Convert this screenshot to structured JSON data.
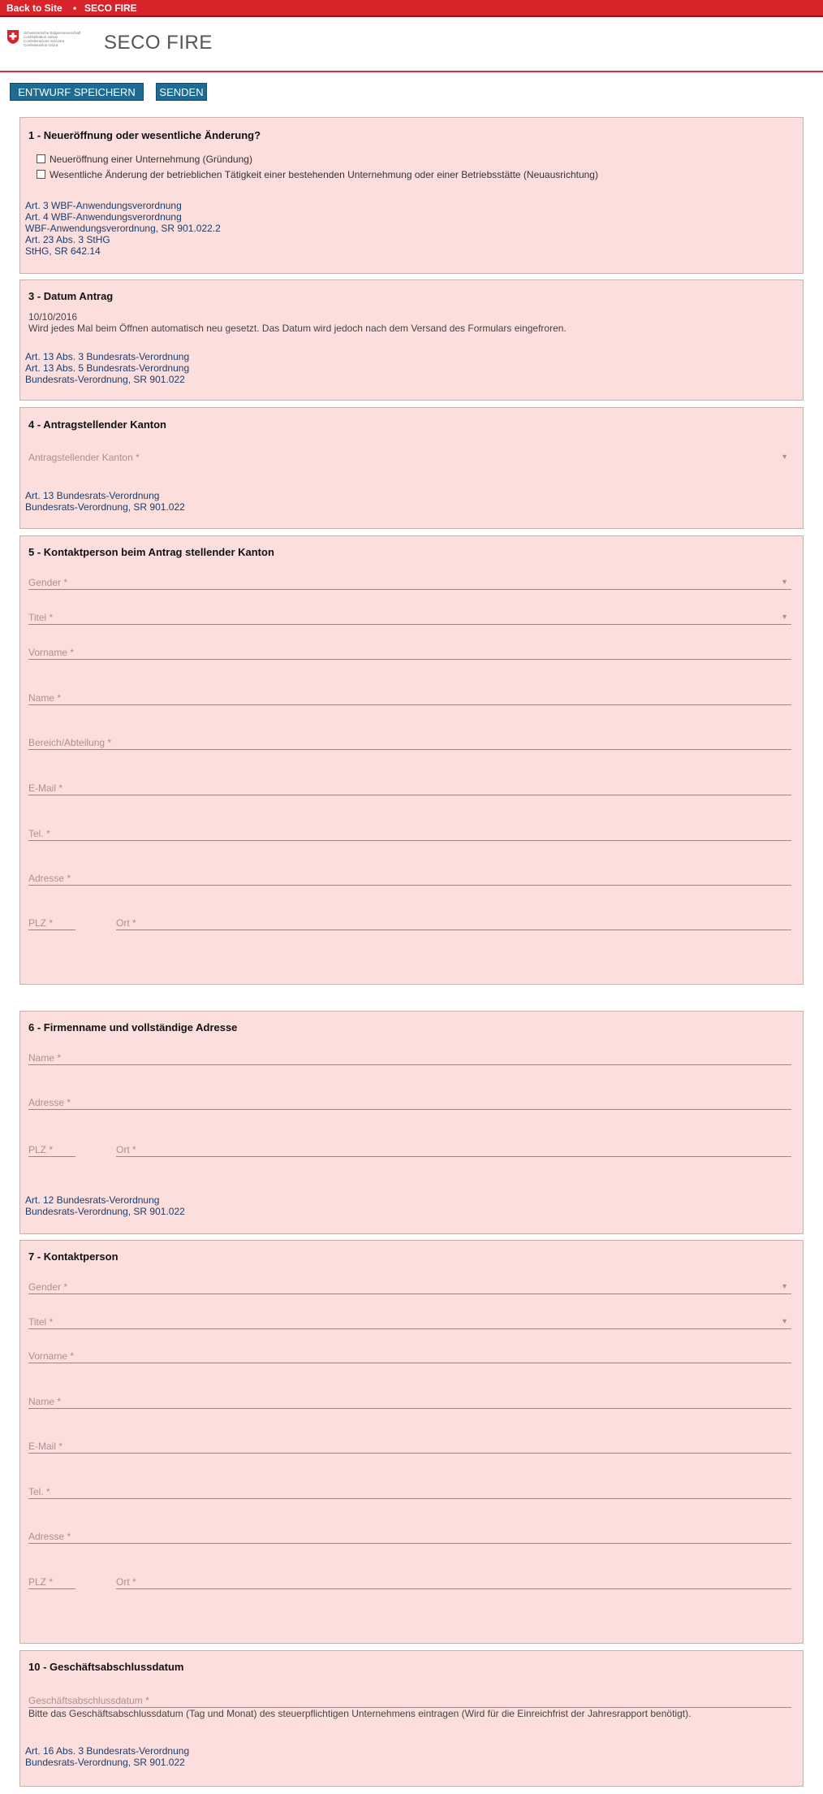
{
  "topbar": {
    "back_link": "Back to Site",
    "separator": "•",
    "site_link": "SECO FIRE"
  },
  "header": {
    "admin_lines": "Schweizerische Eidgenossenschaft\nConfédération suisse\nConfederazione Svizzera\nConfederaziun svizra",
    "site_name": "SECO FIRE"
  },
  "toolbar": {
    "save_draft": "Entwurf speichern",
    "send": "Senden"
  },
  "s1": {
    "title": "1 - Neueröffnung oder wesentliche Änderung?",
    "opt1": "Neueröffnung einer Unternehmung (Gründung)",
    "opt2": "Wesentliche Änderung der betrieblichen Tätigkeit einer bestehenden Unternehmung oder einer Betriebsstätte (Neuausrichtung)",
    "refs": [
      "Art. 3 WBF-Anwendungsverordnung",
      "Art. 4 WBF-Anwendungsverordnung",
      "WBF-Anwendungsverordnung, SR 901.022.2",
      "Art. 23 Abs. 3 StHG",
      "StHG, SR 642.14"
    ]
  },
  "s3": {
    "title": "3 - Datum Antrag",
    "date": "10/10/2016",
    "note": "Wird jedes Mal beim Öffnen automatisch neu gesetzt. Das Datum wird jedoch nach dem Versand des Formulars eingefroren.",
    "refs": [
      "Art. 13 Abs. 3 Bundesrats-Verordnung",
      "Art. 13 Abs. 5 Bundesrats-Verordnung",
      "Bundesrats-Verordnung, SR 901.022"
    ]
  },
  "s4": {
    "title": "4 - Antragstellender Kanton",
    "canton_label": "Antragstellender Kanton *",
    "refs": [
      "Art. 13 Bundesrats-Verordnung",
      "Bundesrats-Verordnung, SR 901.022"
    ]
  },
  "s5": {
    "title": "5 - Kontaktperson beim Antrag stellender Kanton",
    "gender": "Gender *",
    "title_field": "Titel *",
    "firstname": "Vorname *",
    "name": "Name *",
    "department": "Bereich/Abteilung *",
    "email": "E-Mail *",
    "phone": "Tel. *",
    "address": "Adresse *",
    "zip": "PLZ *",
    "city": "Ort *"
  },
  "s6": {
    "title": "6 - Firmenname und vollständige Adresse",
    "name": "Name *",
    "address": "Adresse *",
    "zip": "PLZ *",
    "city": "Ort *",
    "refs": [
      "Art. 12 Bundesrats-Verordnung",
      "Bundesrats-Verordnung, SR 901.022"
    ]
  },
  "s7": {
    "title": "7 - Kontaktperson",
    "gender": "Gender *",
    "title_field": "Titel *",
    "firstname": "Vorname *",
    "name": "Name *",
    "email": "E-Mail *",
    "phone": "Tel. *",
    "address": "Adresse *",
    "zip": "PLZ *",
    "city": "Ort *"
  },
  "s10": {
    "title": "10 - Geschäftsabschlussdatum",
    "date_label": "Geschäftsabschlussdatum *",
    "note": "Bitte das Geschäftsabschlussdatum (Tag und Monat) des steuerpflichtigen Unternehmens eintragen (Wird für die Einreichfrist der Jahresrapport benötigt).",
    "refs": [
      "Art. 16 Abs. 3 Bundesrats-Verordnung",
      "Bundesrats-Verordnung, SR 901.022"
    ]
  },
  "icons": {
    "dropdown": "▼",
    "checkbox": "checkbox-empty",
    "logo": "swiss-cross-shield"
  },
  "colors": {
    "brand_red": "#d8232a",
    "button_blue": "#1f6b93",
    "panel_bg": "#fcdedd",
    "link_blue": "#1c3d6b"
  }
}
